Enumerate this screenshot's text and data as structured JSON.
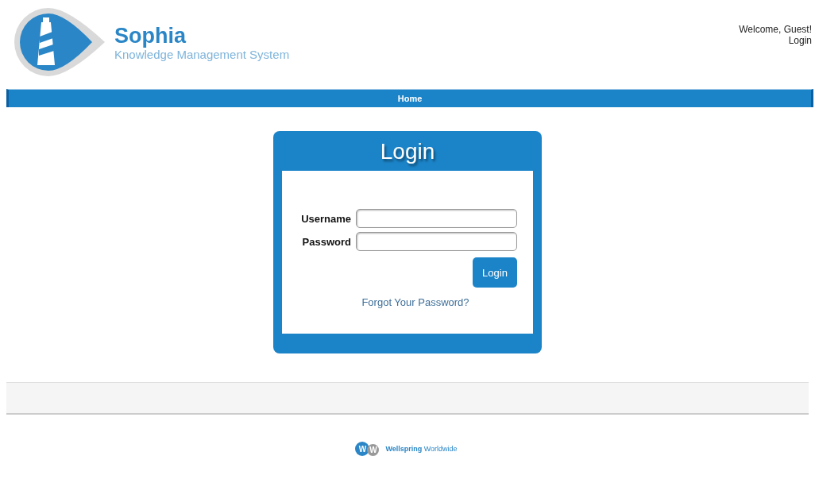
{
  "brand": {
    "name": "Sophia",
    "tagline": "Knowledge Management System"
  },
  "user_area": {
    "greeting": "Welcome, Guest!",
    "login_link": "Login"
  },
  "nav": {
    "items": [
      {
        "label": "Home"
      }
    ]
  },
  "login_card": {
    "title": "Login",
    "fields": [
      {
        "label": "Username"
      },
      {
        "label": "Password"
      }
    ],
    "submit": "Login",
    "forgot_link": "Forgot Your Password?"
  },
  "footer": {
    "logo_letters": [
      "W",
      "W"
    ],
    "company": "**Wellspring** Worldwide"
  }
}
